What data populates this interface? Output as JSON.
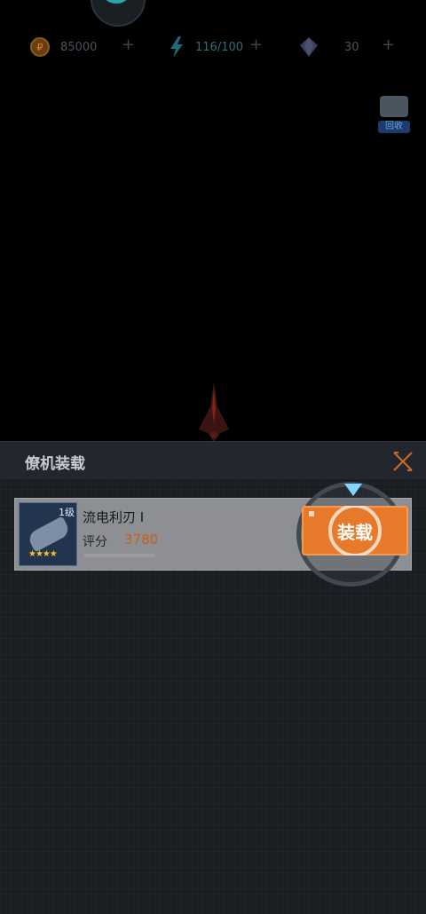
{
  "top_bar": {
    "coins": "85000",
    "energy": "116/100",
    "gems": "30",
    "plus_symbol": "+"
  },
  "recycle": {
    "label": "回收"
  },
  "panel": {
    "title": "僚机装载",
    "close_symbol": "✕"
  },
  "item": {
    "level": "1级",
    "stars": "★★★★",
    "name": "流电利刃 I",
    "score_label": "评分",
    "score": "3780"
  },
  "equip_button": {
    "label": "装载"
  },
  "colors": {
    "accent": "#e6792a",
    "score": "#c95d1d",
    "pointer": "#7fd6ff"
  }
}
